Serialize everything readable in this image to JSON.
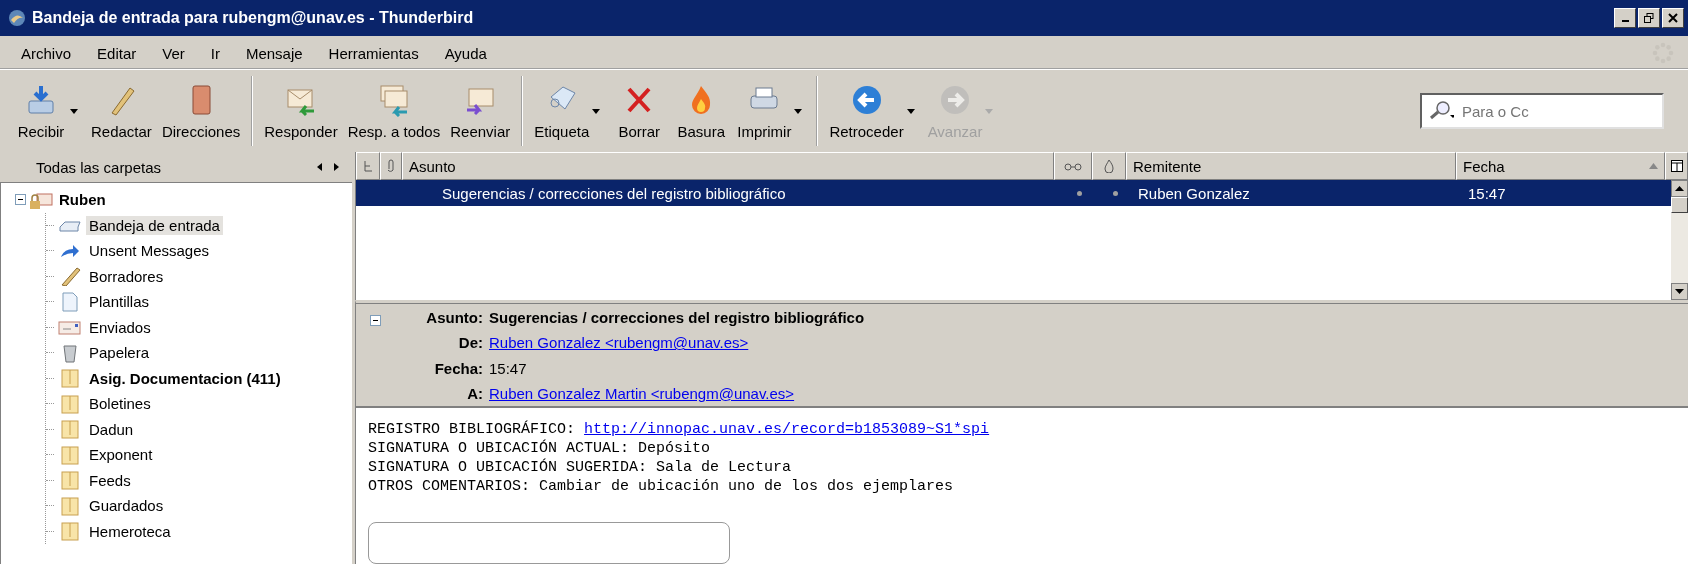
{
  "window": {
    "title": "Bandeja de entrada para rubengm@unav.es - Thunderbird"
  },
  "menu": [
    "Archivo",
    "Editar",
    "Ver",
    "Ir",
    "Mensaje",
    "Herramientas",
    "Ayuda"
  ],
  "toolbar": [
    [
      {
        "label": "Recibir",
        "has_menu": true,
        "disabled": false
      },
      {
        "label": "Redactar",
        "has_menu": false,
        "disabled": false
      },
      {
        "label": "Direcciones",
        "has_menu": false,
        "disabled": false
      }
    ],
    [
      {
        "label": "Responder",
        "has_menu": false,
        "disabled": false
      },
      {
        "label": "Resp. a todos",
        "has_menu": false,
        "disabled": false
      },
      {
        "label": "Reenviar",
        "has_menu": false,
        "disabled": false
      }
    ],
    [
      {
        "label": "Etiqueta",
        "has_menu": true,
        "disabled": false
      },
      {
        "label": "Borrar",
        "has_menu": false,
        "disabled": false
      },
      {
        "label": "Basura",
        "has_menu": false,
        "disabled": false
      },
      {
        "label": "Imprimir",
        "has_menu": true,
        "disabled": false
      }
    ],
    [
      {
        "label": "Retroceder",
        "has_menu": true,
        "disabled": false
      },
      {
        "label": "Avanzar",
        "has_menu": true,
        "disabled": true
      }
    ]
  ],
  "search": {
    "placeholder": "Para o Cc"
  },
  "folder_pane": {
    "title": "Todas las carpetas",
    "tree": [
      {
        "label": "Ruben",
        "kind": "account",
        "expanded": true,
        "unread": true,
        "selected": false,
        "children": [
          {
            "label": "Bandeja de entrada",
            "kind": "inbox",
            "unread": false,
            "selected": true
          },
          {
            "label": "Unsent Messages",
            "kind": "outbox",
            "unread": false,
            "selected": false
          },
          {
            "label": "Borradores",
            "kind": "drafts",
            "unread": false,
            "selected": false
          },
          {
            "label": "Plantillas",
            "kind": "templates",
            "unread": false,
            "selected": false
          },
          {
            "label": "Enviados",
            "kind": "sent",
            "unread": false,
            "selected": false
          },
          {
            "label": "Papelera",
            "kind": "trash",
            "unread": false,
            "selected": false
          },
          {
            "label": "Asig. Documentacion (411)",
            "kind": "folder",
            "unread": true,
            "selected": false
          },
          {
            "label": "Boletines",
            "kind": "folder",
            "unread": false,
            "selected": false
          },
          {
            "label": "Dadun",
            "kind": "folder",
            "unread": false,
            "selected": false
          },
          {
            "label": "Exponent",
            "kind": "folder",
            "unread": false,
            "selected": false
          },
          {
            "label": "Feeds",
            "kind": "folder",
            "unread": false,
            "selected": false
          },
          {
            "label": "Guardados",
            "kind": "folder",
            "unread": false,
            "selected": false
          },
          {
            "label": "Hemeroteca",
            "kind": "folder",
            "unread": false,
            "selected": false
          }
        ]
      }
    ]
  },
  "message_list": {
    "columns": [
      "Asunto",
      "Remitente",
      "Fecha"
    ],
    "rows": [
      {
        "subject": "Sugerencias / correcciones del registro bibliográfico",
        "sender": "Ruben Gonzalez",
        "date": "15:47",
        "selected": true
      }
    ]
  },
  "message": {
    "fields": [
      {
        "label": "Asunto:",
        "value": "Sugerencias / correcciones del registro bibliográfico",
        "kind": "subject"
      },
      {
        "label": "De:",
        "value": "Ruben Gonzalez <rubengm@unav.es>",
        "kind": "link"
      },
      {
        "label": "Fecha:",
        "value": "15:47",
        "kind": "text"
      },
      {
        "label": "A:",
        "value": "Ruben Gonzalez Martin <rubengm@unav.es>",
        "kind": "link"
      }
    ],
    "body": [
      {
        "text": "REGISTRO BIBLIOGRÁFICO: ",
        "link": "http://innopac.unav.es/record=b1853089~S1*spi"
      },
      {
        "text": "SIGNATURA O UBICACIÓN ACTUAL: Depósito"
      },
      {
        "text": "SIGNATURA O UBICACIÓN SUGERIDA: Sala de Lectura"
      },
      {
        "text": "OTROS COMENTARIOS: Cambiar de ubicación uno de los dos ejemplares"
      }
    ]
  }
}
